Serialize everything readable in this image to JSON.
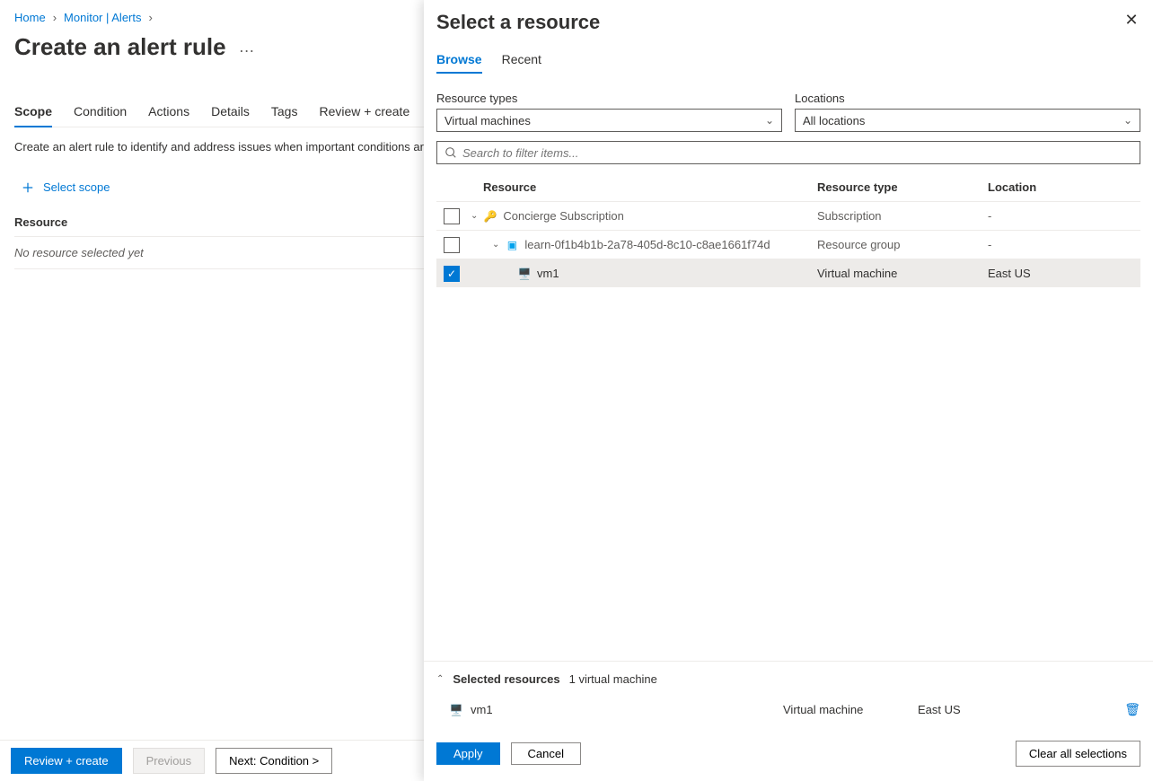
{
  "breadcrumb": {
    "home": "Home",
    "monitor": "Monitor | Alerts"
  },
  "pageTitle": "Create an alert rule",
  "tabs": {
    "scope": "Scope",
    "condition": "Condition",
    "actions": "Actions",
    "details": "Details",
    "tags": "Tags",
    "review": "Review + create"
  },
  "description": "Create an alert rule to identify and address issues when important conditions are found in your monitoring data.",
  "selectScope": "Select scope",
  "resourceHeader": "Resource",
  "noResource": "No resource selected yet",
  "footer": {
    "reviewCreate": "Review + create",
    "previous": "Previous",
    "next": "Next: Condition >"
  },
  "panel": {
    "title": "Select a resource",
    "tabs": {
      "browse": "Browse",
      "recent": "Recent"
    },
    "filters": {
      "resourceTypesLabel": "Resource types",
      "resourceTypesValue": "Virtual machines",
      "locationsLabel": "Locations",
      "locationsValue": "All locations"
    },
    "searchPlaceholder": "Search to filter items...",
    "columns": {
      "resource": "Resource",
      "type": "Resource type",
      "location": "Location"
    },
    "rows": [
      {
        "name": "Concierge Subscription",
        "type": "Subscription",
        "location": "-",
        "indent": 1,
        "icon": "sub",
        "checked": false
      },
      {
        "name": "learn-0f1b4b1b-2a78-405d-8c10-c8ae1661f74d",
        "type": "Resource group",
        "location": "-",
        "indent": 2,
        "icon": "rg",
        "checked": false
      },
      {
        "name": "vm1",
        "type": "Virtual machine",
        "location": "East US",
        "indent": 3,
        "icon": "vm",
        "checked": true
      }
    ],
    "selected": {
      "heading": "Selected resources",
      "count": "1 virtual machine",
      "items": [
        {
          "name": "vm1",
          "type": "Virtual machine",
          "location": "East US"
        }
      ]
    },
    "footer": {
      "apply": "Apply",
      "cancel": "Cancel",
      "clear": "Clear all selections"
    }
  }
}
